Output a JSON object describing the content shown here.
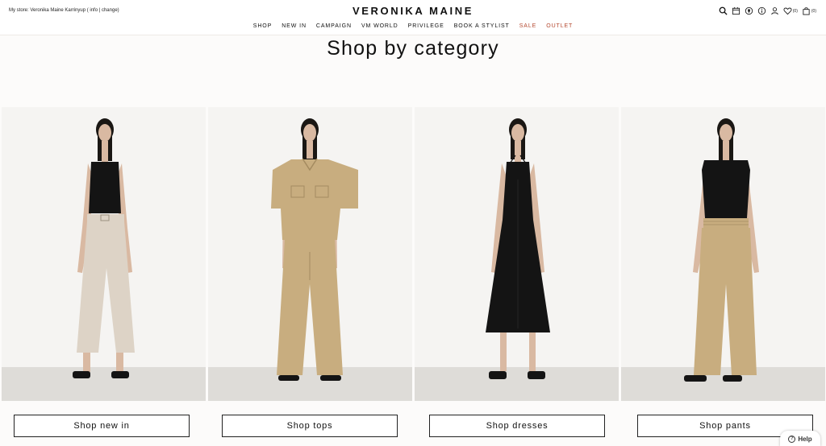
{
  "header": {
    "store_prefix": "My store: Veronika Maine Karrinyup ( ",
    "store_info": "info",
    "store_sep": " | ",
    "store_change": "change",
    "store_suffix": ")",
    "logo": "VERONIKA MAINE",
    "nav": [
      "SHOP",
      "NEW IN",
      "CAMPAIGN",
      "VM WORLD",
      "PRIVILEGE",
      "BOOK A STYLIST",
      "SALE",
      "OUTLET"
    ],
    "wishlist_count": "(0)",
    "bag_count": "(0)"
  },
  "heading": "Shop by category",
  "categories": [
    {
      "button": "Shop new in"
    },
    {
      "button": "Shop tops"
    },
    {
      "button": "Shop dresses"
    },
    {
      "button": "Shop pants"
    }
  ],
  "help": {
    "label": "Help"
  },
  "colors": {
    "sale": "#b4482f",
    "outlet": "#b4482f",
    "beige": "#c8ad7f",
    "black": "#141414",
    "sand": "#ddd3c6"
  },
  "icons": [
    "search-icon",
    "calendar-icon",
    "store-pin-icon",
    "info-icon",
    "account-icon",
    "wishlist-icon",
    "bag-icon",
    "help-icon"
  ]
}
